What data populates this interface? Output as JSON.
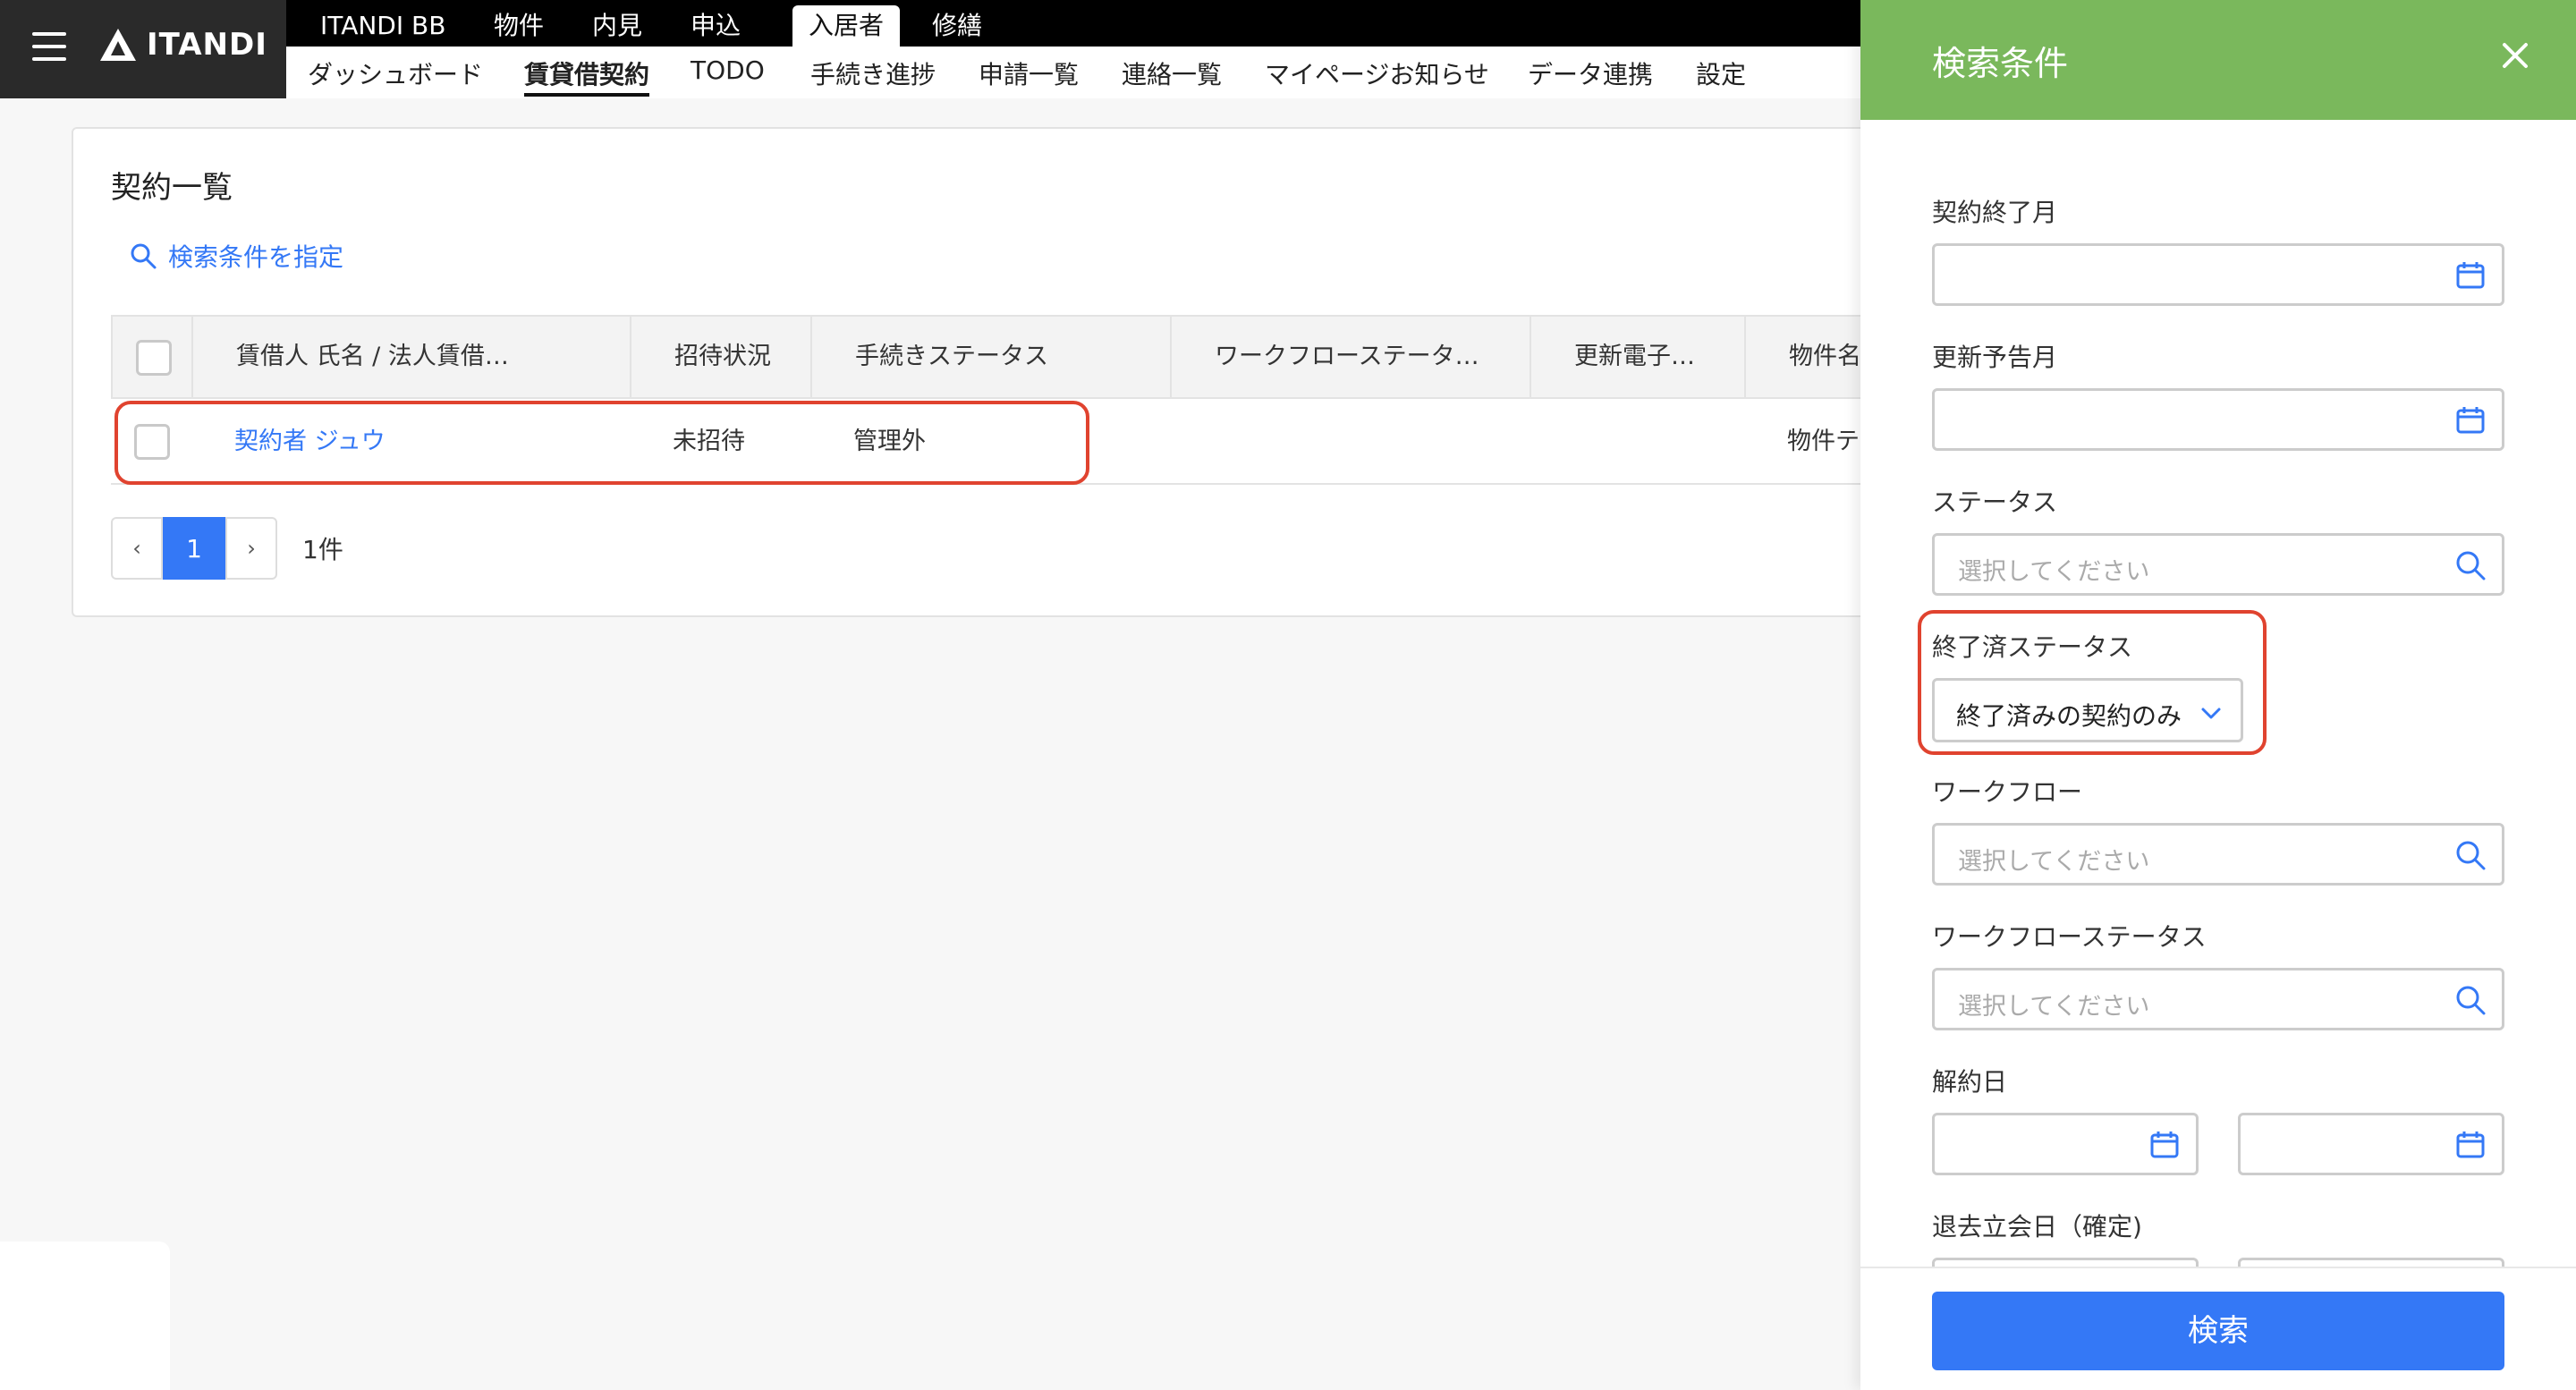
{
  "header": {
    "logo_text": "ITANDI",
    "top_nav": [
      "ITANDI BB",
      "物件",
      "内見",
      "申込",
      "入居者",
      "修繕"
    ],
    "active_top": "入居者",
    "sub_nav": [
      "ダッシュボード",
      "賃貸借契約",
      "TODO",
      "手続き進捗",
      "申請一覧",
      "連絡一覧",
      "マイページお知らせ",
      "データ連携",
      "設定"
    ],
    "active_sub": "賃貸借契約"
  },
  "main": {
    "title": "契約一覧",
    "search_link": "検索条件を指定",
    "columns": [
      "賃借人 氏名 / 法人賃借…",
      "招待状況",
      "手続きステータス",
      "ワークフローステータ…",
      "更新電子…",
      "物件名"
    ],
    "rows": [
      {
        "name": "契約者 ジュウ",
        "invite": "未招待",
        "procedure": "管理外",
        "workflow": "",
        "renewal": "",
        "property": "物件テストB"
      }
    ],
    "pager": {
      "prev": "‹",
      "current": "1",
      "next": "›",
      "count": "1件"
    }
  },
  "panel": {
    "title": "検索条件",
    "fields": {
      "contract_end_month": "契約終了月",
      "renewal_month": "更新予告月",
      "status": "ステータス",
      "status_placeholder": "選択してください",
      "ended_status": "終了済ステータス",
      "ended_status_value": "終了済みの契約のみ",
      "workflow": "ワークフロー",
      "workflow_placeholder": "選択してください",
      "workflow_status": "ワークフローステータス",
      "workflow_status_placeholder": "選択してください",
      "cancel_date": "解約日",
      "tilde": "〜",
      "moveout_date": "退去立会日（確定)"
    },
    "search_button": "検索"
  },
  "colors": {
    "accent": "#3478f6",
    "panel_header": "#7ab85c",
    "highlight": "#e0432f",
    "nav_bg": "#000000"
  }
}
